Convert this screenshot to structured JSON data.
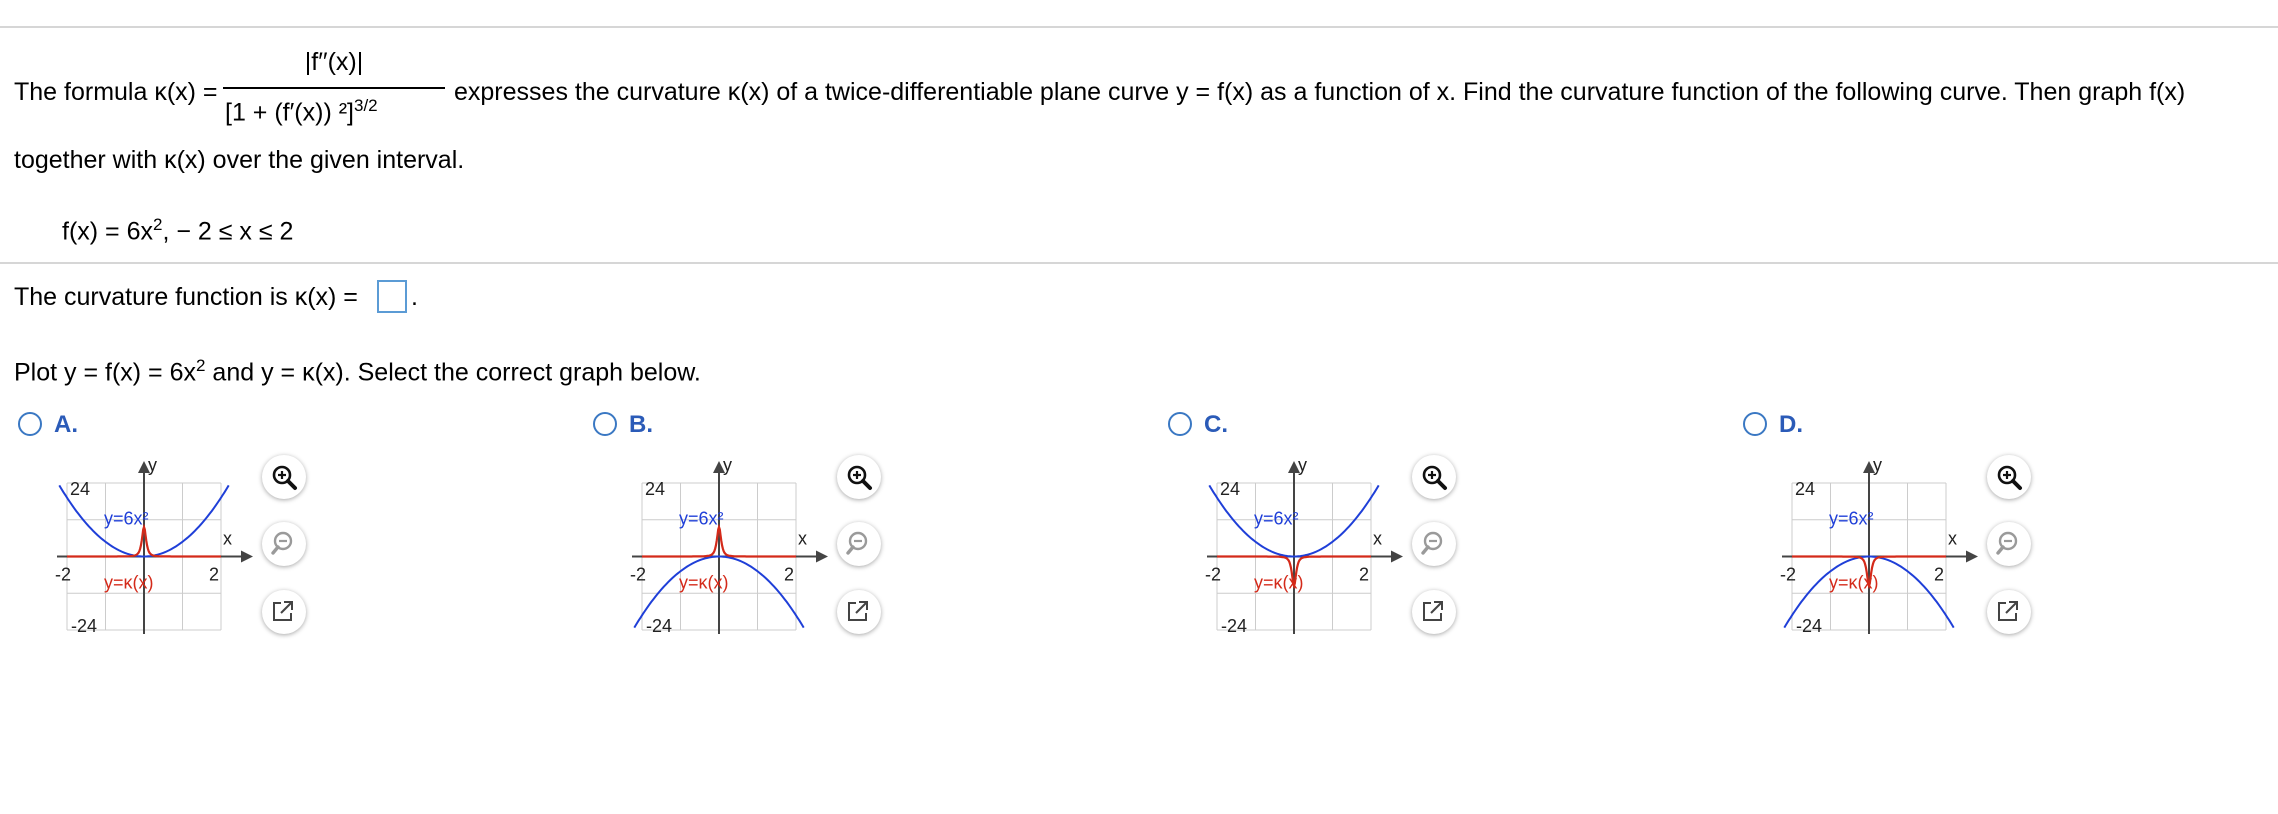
{
  "problem": {
    "intro_prefix": "The formula κ(x) =",
    "frac_numerator": "|f′′(x)|",
    "frac_denominator_base": "[1 + (f′(x)) ²]",
    "frac_denominator_exp": "3/2",
    "intro_suffix": "expresses the curvature κ(x) of a twice-differentiable plane curve y = f(x) as a function of x. Find the curvature function of the following curve. Then graph f(x)",
    "intro_line2": "together with κ(x) over the given interval.",
    "function_base": "f(x) = 6x",
    "function_exp": "2",
    "function_interval": ",  − 2 ≤ x ≤ 2"
  },
  "question1": {
    "prefix": "The curvature function is κ(x) =",
    "suffix": "."
  },
  "question2": {
    "prefix": "Plot y = f(x) = 6x",
    "exp": "2",
    "suffix": " and y = κ(x). Select the correct graph below."
  },
  "options": [
    {
      "letter": "A.",
      "f_curve": "opens-up",
      "k_curve": "peak-up",
      "selected": false
    },
    {
      "letter": "B.",
      "f_curve": "opens-down",
      "k_curve": "peak-up",
      "selected": false
    },
    {
      "letter": "C.",
      "f_curve": "opens-up",
      "k_curve": "peak-down",
      "selected": false
    },
    {
      "letter": "D.",
      "f_curve": "opens-down",
      "k_curve": "peak-down",
      "selected": false
    }
  ],
  "graph_labels": {
    "y_axis": "y",
    "x_axis": "x",
    "y_top": "24",
    "y_bottom": "-24",
    "x_left": "-2",
    "x_right": "2",
    "f_label": "y=6x²",
    "k_label": "y=κ(x)"
  },
  "tools": [
    "zoom-in",
    "zoom-out",
    "open-in-new"
  ],
  "colors": {
    "f_curve": "#1f3fd8",
    "k_curve": "#d42a1a",
    "option_letter": "#2b5bb8",
    "radio": "#3a78c3",
    "answer_box": "#5b9bd5",
    "grid": "#cccccc",
    "rule": "#d6d6d6"
  }
}
